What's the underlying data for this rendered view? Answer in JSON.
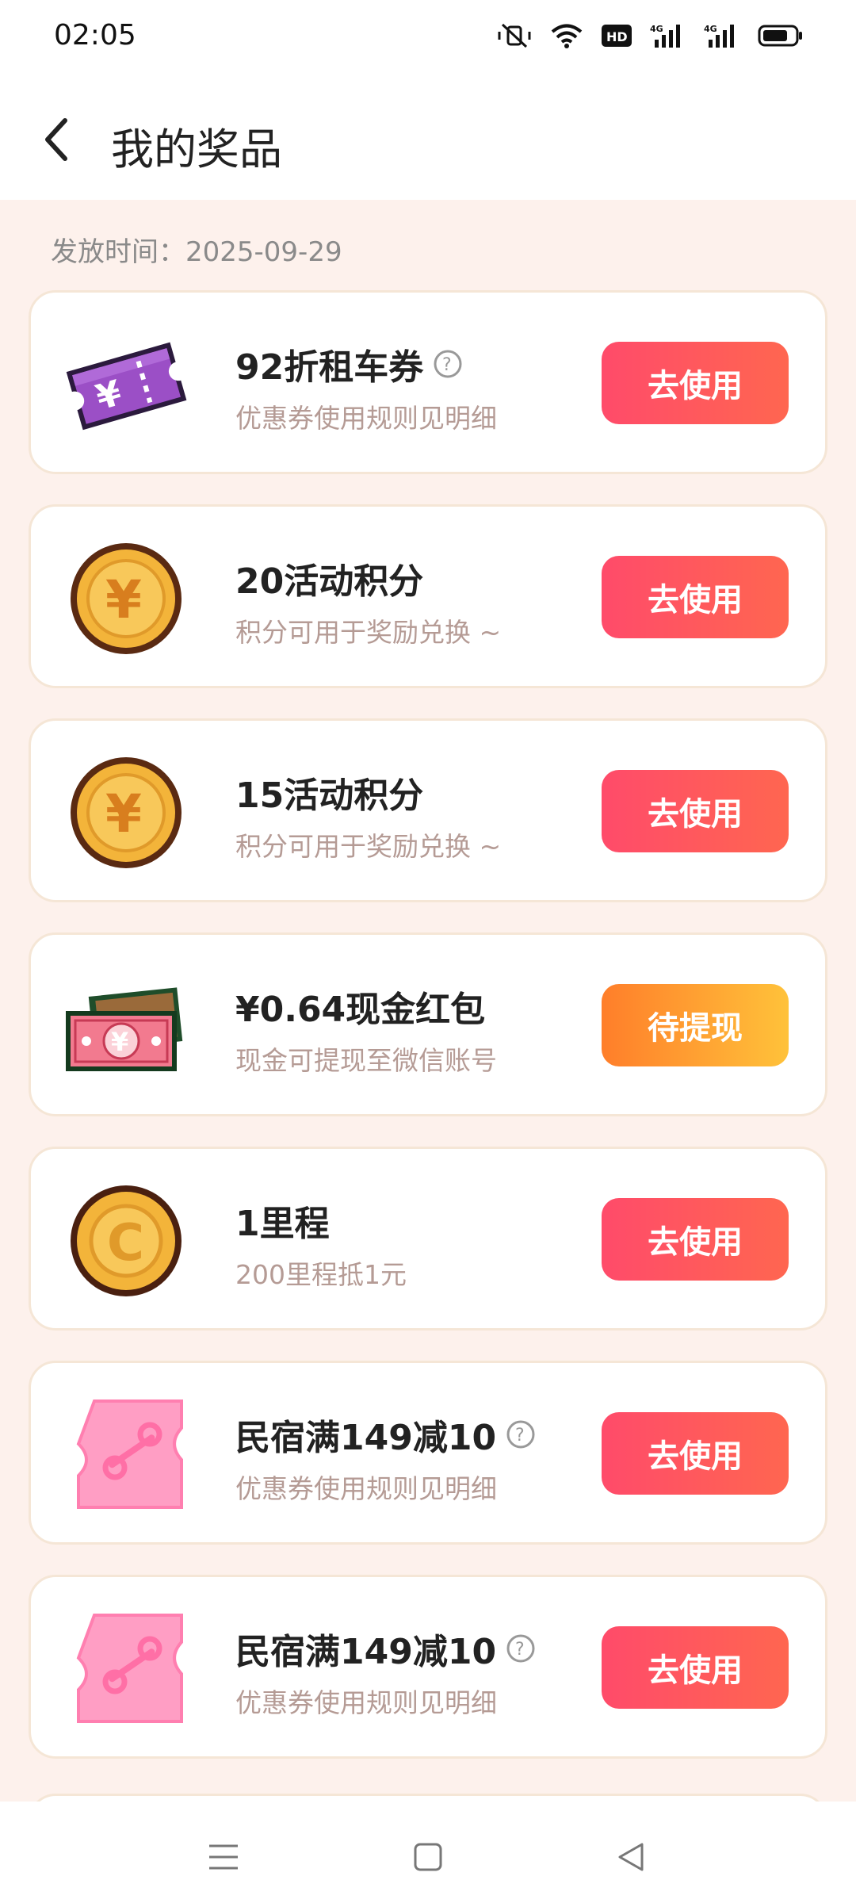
{
  "status_bar": {
    "time": "02:05"
  },
  "header": {
    "title": "我的奖品"
  },
  "issue_date": "发放时间：2025-09-29",
  "prizes": [
    {
      "title": "92折租车券",
      "subtitle": "优惠券使用规则见明细",
      "button": "去使用",
      "icon": "rental-coupon-icon"
    },
    {
      "title": "20活动积分",
      "subtitle": "积分可用于奖励兑换 ~",
      "button": "去使用",
      "icon": "coin-icon"
    },
    {
      "title": "15活动积分",
      "subtitle": "积分可用于奖励兑换 ~",
      "button": "去使用",
      "icon": "coin-icon"
    },
    {
      "title": "¥0.64现金红包",
      "subtitle": "现金可提现至微信账号",
      "button": "待提现",
      "icon": "cash-icon"
    },
    {
      "title": "1里程",
      "subtitle": "200里程抵1元",
      "button": "去使用",
      "icon": "mileage-coin-icon"
    },
    {
      "title": "民宿满149减10",
      "subtitle": "优惠券使用规则见明细",
      "button": "去使用",
      "icon": "discount-ticket-icon"
    },
    {
      "title": "民宿满149减10",
      "subtitle": "优惠券使用规则见明细",
      "button": "去使用",
      "icon": "discount-ticket-icon"
    }
  ],
  "colors": {
    "use_button": "#ff4b6a",
    "withdraw_button": "#ff9a30",
    "page_background": "#fdf1ec"
  }
}
